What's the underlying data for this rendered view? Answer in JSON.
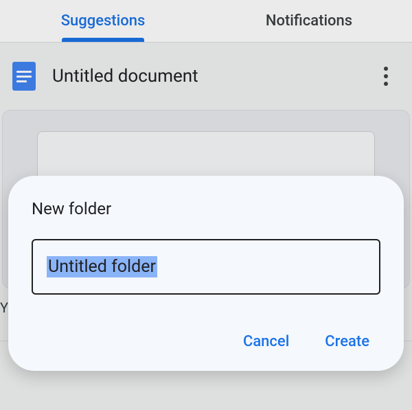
{
  "tabs": {
    "suggestions": "Suggestions",
    "notifications": "Notifications"
  },
  "document": {
    "title": "Untitled document"
  },
  "section": {
    "label_partial": "Yo"
  },
  "dialog": {
    "title": "New folder",
    "input_value": "Untitled folder",
    "cancel_label": "Cancel",
    "create_label": "Create"
  },
  "colors": {
    "accent": "#1a73e8",
    "selection": "#8ab4f8"
  }
}
